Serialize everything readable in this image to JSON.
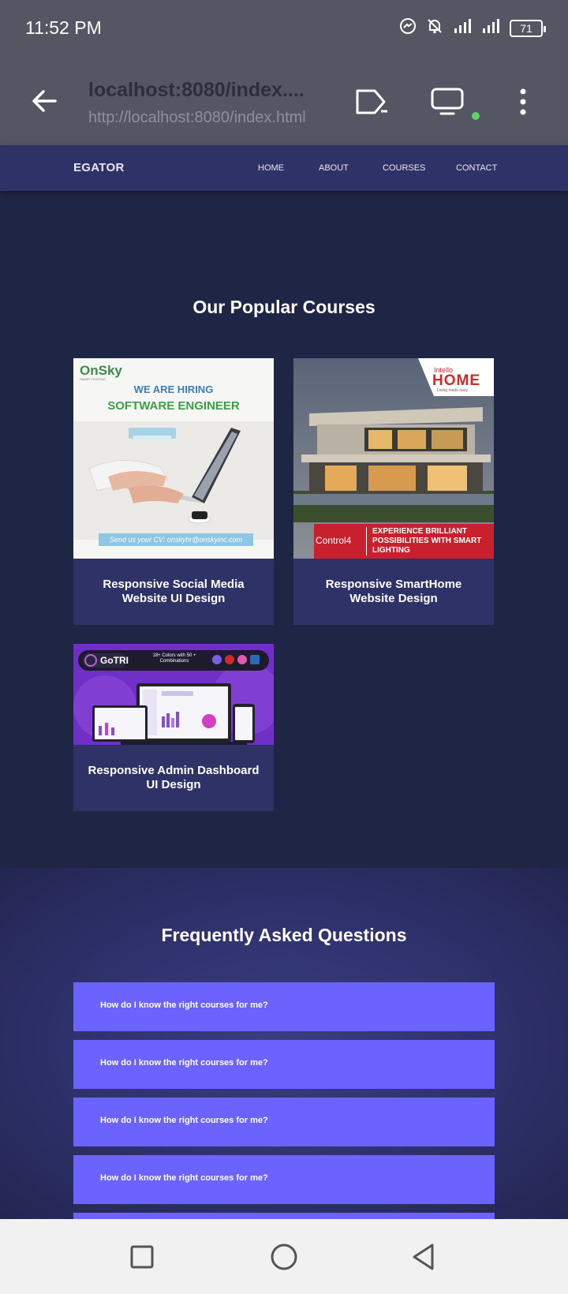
{
  "status_bar": {
    "time": "11:52 PM",
    "battery": "71",
    "icons": [
      "messenger-icon",
      "bell-off-icon",
      "signal-icon",
      "signal-icon",
      "battery-icon"
    ]
  },
  "browser": {
    "url_title": "localhost:8080/index....",
    "url": "http://localhost:8080/index.html",
    "icons": [
      "back-arrow-icon",
      "cast-icon",
      "desktop-icon",
      "more-vert-icon"
    ]
  },
  "site_nav": {
    "brand": "EGATOR",
    "links": [
      "HOME",
      "ABOUT",
      "COURSES",
      "CONTACT"
    ]
  },
  "courses": {
    "title": "Our Popular Courses",
    "items": [
      {
        "title": "Responsive Social Media Website UI Design",
        "image": {
          "logo": "OnSky",
          "logo_sub": "SMART HOSTING",
          "line1": "WE ARE HIRING",
          "line2": "SOFTWARE ENGINEER",
          "footer": "Send us your CV: onskyhr@onskyinc.com"
        }
      },
      {
        "title": "Responsive SmartHome Website Design",
        "image": {
          "brand_top": "Intello",
          "brand_main": "HOME",
          "brand_sub": "Living made easy",
          "partner": "Control4",
          "banner": "EXPERIENCE BRILLIANT POSSIBILITIES WITH SMART LIGHTING"
        }
      },
      {
        "title": "Responsive Admin Dashboard UI Design",
        "image": {
          "brand": "GoTRI",
          "tagline": "18+ Colors with 50 + Combinations"
        }
      }
    ]
  },
  "faq": {
    "title": "Frequently Asked Questions",
    "items": [
      "How do I know the right courses for me?",
      "How do I know the right courses for me?",
      "How do I know the right courses for me?",
      "How do I know the right courses for me?"
    ]
  },
  "android_nav": [
    "recents-square-icon",
    "home-circle-icon",
    "back-triangle-icon"
  ]
}
